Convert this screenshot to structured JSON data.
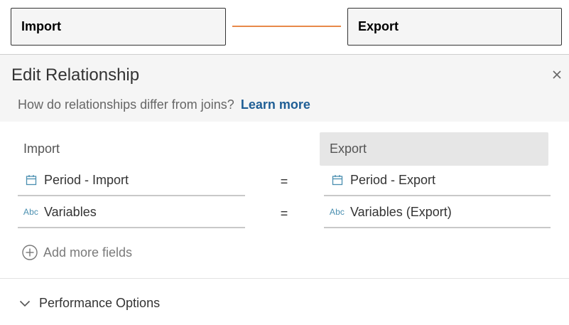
{
  "canvas": {
    "left_table": "Import",
    "right_table": "Export",
    "noodle_color": "#e8894a"
  },
  "dialog": {
    "title": "Edit Relationship",
    "subtitle": "How do relationships differ from joins?",
    "learn_more": "Learn more",
    "close_icon": "close-icon"
  },
  "mapping": {
    "left_header": "Import",
    "right_header": "Export",
    "rows": [
      {
        "left_icon": "calendar-icon",
        "left": "Period - Import",
        "operator": "=",
        "right_icon": "calendar-icon",
        "right": "Period - Export"
      },
      {
        "left_icon": "string-abc-icon",
        "left_icon_text": "Abc",
        "left": "Variables",
        "operator": "=",
        "right_icon": "string-abc-icon",
        "right_icon_text": "Abc",
        "right": "Variables (Export)"
      }
    ],
    "add_more": "Add more fields"
  },
  "performance": {
    "label": "Performance Options"
  }
}
